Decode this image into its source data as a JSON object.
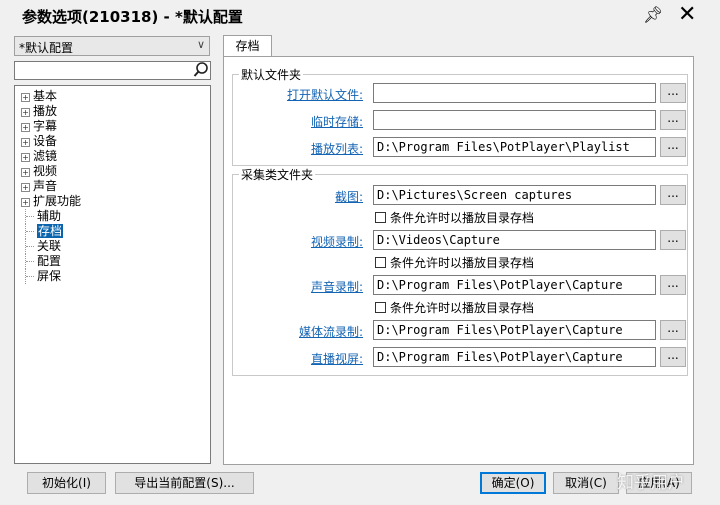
{
  "window": {
    "title": "参数选项(210318) - *默认配置",
    "pin_icon": "pin-icon",
    "close_icon": "close-icon"
  },
  "preset_select": {
    "value": "*默认配置"
  },
  "search": {
    "value": "",
    "icon": "search-icon"
  },
  "tree": {
    "items": [
      {
        "label": "基本",
        "expandable": true
      },
      {
        "label": "播放",
        "expandable": true
      },
      {
        "label": "字幕",
        "expandable": true
      },
      {
        "label": "设备",
        "expandable": true
      },
      {
        "label": "滤镜",
        "expandable": true
      },
      {
        "label": "视频",
        "expandable": true
      },
      {
        "label": "声音",
        "expandable": true
      },
      {
        "label": "扩展功能",
        "expandable": true
      },
      {
        "label": "辅助",
        "expandable": false
      },
      {
        "label": "存档",
        "expandable": false,
        "selected": true
      },
      {
        "label": "关联",
        "expandable": false
      },
      {
        "label": "配置",
        "expandable": false
      },
      {
        "label": "屏保",
        "expandable": false
      }
    ]
  },
  "tab": {
    "label": "存档"
  },
  "default_folders": {
    "title": "默认文件夹",
    "rows": [
      {
        "label": "打开默认文件:",
        "value": "",
        "button": "..."
      },
      {
        "label": "临时存储:",
        "value": "",
        "button": "..."
      },
      {
        "label": "播放列表:",
        "value": "D:\\Program Files\\PotPlayer\\Playlist",
        "button": "..."
      }
    ]
  },
  "capture_folders": {
    "title": "采集类文件夹",
    "rows": [
      {
        "label": "截图:",
        "value": "D:\\Pictures\\Screen captures",
        "button": "..."
      },
      {
        "label": "视频录制:",
        "value": "D:\\Videos\\Capture",
        "button": "..."
      },
      {
        "label": "声音录制:",
        "value": "D:\\Program Files\\PotPlayer\\Capture",
        "button": "..."
      },
      {
        "label": "媒体流录制:",
        "value": "D:\\Program Files\\PotPlayer\\Capture",
        "button": "..."
      },
      {
        "label": "直播视屏:",
        "value": "D:\\Program Files\\PotPlayer\\Capture",
        "button": "..."
      }
    ],
    "checkbox_label": "条件允许时以播放目录存档"
  },
  "footer": {
    "init_button": "初始化(I)",
    "export_button": "导出当前配置(S)...",
    "ok_button": "确定(O)",
    "cancel_button": "取消(C)",
    "apply_button": "应用(A)"
  },
  "watermark": "知乎用户"
}
